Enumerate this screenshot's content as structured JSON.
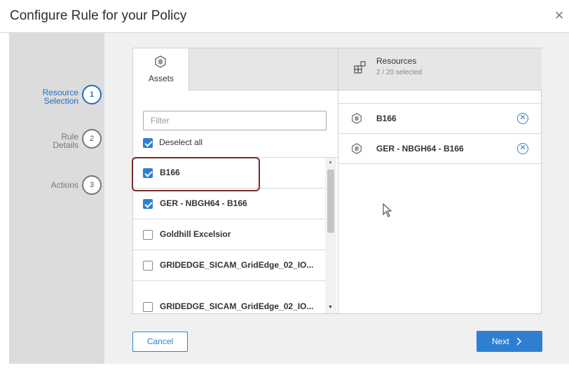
{
  "dialog": {
    "title": "Configure Rule for your Policy",
    "close_icon": "close-icon",
    "close_glyph": "×"
  },
  "steps": [
    {
      "label_line1": "Resource",
      "label_line2": "Selection",
      "number": "1",
      "state": "active"
    },
    {
      "label_line1": "Rule",
      "label_line2": "Details",
      "number": "2",
      "state": "inactive"
    },
    {
      "label_line1": "Actions",
      "label_line2": "",
      "number": "3",
      "state": "inactive"
    }
  ],
  "assets_tab": {
    "label": "Assets",
    "icon": "asset-icon"
  },
  "filter": {
    "placeholder": "Filter",
    "value": ""
  },
  "deselect_all": {
    "label": "Deselect all",
    "checked": true
  },
  "asset_list": [
    {
      "label": "B166",
      "checked": true
    },
    {
      "label": "GER - NBGH64 - B166",
      "checked": true
    },
    {
      "label": "Goldhill Excelsior",
      "checked": false
    },
    {
      "label": "GRIDEDGE_SICAM_GridEdge_02_IO...",
      "checked": false
    },
    {
      "label": "GRIDEDGE_SICAM_GridEdge_02_IO...",
      "checked": false
    }
  ],
  "resources": {
    "title": "Resources",
    "count": "2 / 20 selected",
    "icon": "resources-icon",
    "selected": [
      {
        "label": "B166",
        "icon": "asset-icon",
        "remove_icon": "remove-icon"
      },
      {
        "label": "GER - NBGH64 - B166",
        "icon": "asset-icon",
        "remove_icon": "remove-icon"
      }
    ]
  },
  "footer": {
    "cancel_label": "Cancel",
    "next_label": "Next"
  },
  "colors": {
    "accent": "#2f7fd1",
    "highlight": "#7a2b2b",
    "stepper_bg": "#dcdcdc",
    "content_bg": "#f0f0f0"
  }
}
